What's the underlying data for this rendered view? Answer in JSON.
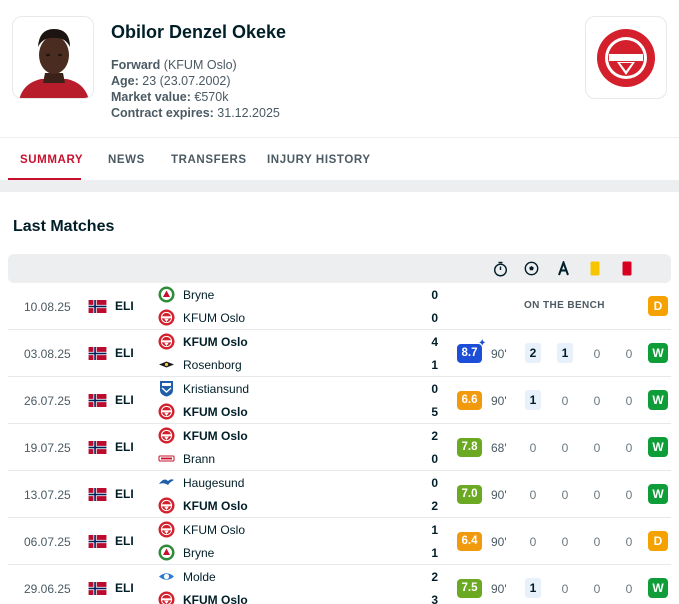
{
  "player": {
    "name": "Obilor Denzel Okeke",
    "position_label": "Forward",
    "club_paren": "(KFUM Oslo)",
    "age_label": "Age:",
    "age_value": "23 (23.07.2002)",
    "market_label": "Market value:",
    "market_value": "€570k",
    "contract_label": "Contract expires:",
    "contract_value": "31.12.2025"
  },
  "tabs": [
    {
      "label": "SUMMARY",
      "active": true
    },
    {
      "label": "NEWS",
      "active": false
    },
    {
      "label": "TRANSFERS",
      "active": false
    },
    {
      "label": "INJURY HISTORY",
      "active": false
    }
  ],
  "section_title": "Last Matches",
  "columns": [
    "stopwatch-icon",
    "ball-icon",
    "assist-icon",
    "yellow-card-icon",
    "red-card-icon"
  ],
  "colors": {
    "accent": "#c8102e",
    "win": "#0f9d3a",
    "draw": "#f5a100",
    "rating_high": "#1d4ed8",
    "rating_green": "#6aa921",
    "rating_orange": "#f29a0d"
  },
  "matches": [
    {
      "date": "10.08.25",
      "league": "ELI",
      "home": {
        "name": "Bryne",
        "bold": false,
        "score": "0",
        "logo": "bryne"
      },
      "away": {
        "name": "KFUM Oslo",
        "bold": false,
        "score": "0",
        "logo": "kfum"
      },
      "bench": "ON THE BENCH",
      "result": "D"
    },
    {
      "date": "03.08.25",
      "league": "ELI",
      "home": {
        "name": "KFUM Oslo",
        "bold": true,
        "score": "4",
        "logo": "kfum"
      },
      "away": {
        "name": "Rosenborg",
        "bold": false,
        "score": "1",
        "logo": "rosenborg"
      },
      "rating": "8.7",
      "rating_color": "#1d4ed8",
      "star": true,
      "minutes": "90'",
      "goals": "2",
      "assists": "1",
      "yellow": "0",
      "red": "0",
      "result": "W"
    },
    {
      "date": "26.07.25",
      "league": "ELI",
      "home": {
        "name": "Kristiansund",
        "bold": false,
        "score": "0",
        "logo": "kristiansund"
      },
      "away": {
        "name": "KFUM Oslo",
        "bold": true,
        "score": "5",
        "logo": "kfum"
      },
      "rating": "6.6",
      "rating_color": "#f29a0d",
      "minutes": "90'",
      "goals": "1",
      "assists": "0",
      "yellow": "0",
      "red": "0",
      "result": "W"
    },
    {
      "date": "19.07.25",
      "league": "ELI",
      "home": {
        "name": "KFUM Oslo",
        "bold": true,
        "score": "2",
        "logo": "kfum"
      },
      "away": {
        "name": "Brann",
        "bold": false,
        "score": "0",
        "logo": "brann"
      },
      "rating": "7.8",
      "rating_color": "#6aa921",
      "minutes": "68'",
      "goals": "0",
      "assists": "0",
      "yellow": "0",
      "red": "0",
      "result": "W"
    },
    {
      "date": "13.07.25",
      "league": "ELI",
      "home": {
        "name": "Haugesund",
        "bold": false,
        "score": "0",
        "logo": "haugesund"
      },
      "away": {
        "name": "KFUM Oslo",
        "bold": true,
        "score": "2",
        "logo": "kfum"
      },
      "rating": "7.0",
      "rating_color": "#6aa921",
      "minutes": "90'",
      "goals": "0",
      "assists": "0",
      "yellow": "0",
      "red": "0",
      "result": "W"
    },
    {
      "date": "06.07.25",
      "league": "ELI",
      "home": {
        "name": "KFUM Oslo",
        "bold": false,
        "score": "1",
        "logo": "kfum"
      },
      "away": {
        "name": "Bryne",
        "bold": false,
        "score": "1",
        "logo": "bryne"
      },
      "rating": "6.4",
      "rating_color": "#f29a0d",
      "minutes": "90'",
      "goals": "0",
      "assists": "0",
      "yellow": "0",
      "red": "0",
      "result": "D"
    },
    {
      "date": "29.06.25",
      "league": "ELI",
      "home": {
        "name": "Molde",
        "bold": false,
        "score": "2",
        "logo": "molde"
      },
      "away": {
        "name": "KFUM Oslo",
        "bold": true,
        "score": "3",
        "logo": "kfum"
      },
      "rating": "7.5",
      "rating_color": "#6aa921",
      "minutes": "90'",
      "goals": "1",
      "assists": "0",
      "yellow": "0",
      "red": "0",
      "result": "W"
    }
  ]
}
